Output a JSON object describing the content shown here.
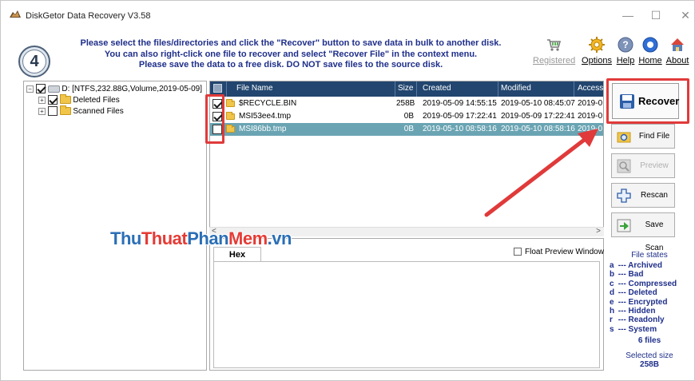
{
  "window": {
    "title": "DiskGetor Data Recovery V3.58",
    "controls": {
      "minimize": "—",
      "maximize": "☐",
      "close": "✕"
    }
  },
  "header": {
    "step": "4",
    "instructions": [
      "Please select the files/directories and click the \"Recover\" button to save data in bulk to another disk.",
      "You can also right-click one file to recover and select \"Recover File\" in the context menu.",
      "Please save the data to a free disk. DO NOT save files to the source disk."
    ],
    "links": [
      {
        "label": "Registered",
        "icon": "cart-icon",
        "disabled": true
      },
      {
        "label": "Options",
        "icon": "gear-icon",
        "disabled": false
      },
      {
        "label": "Help",
        "icon": "help-icon",
        "disabled": false
      },
      {
        "label": "Home",
        "icon": "home-circle-icon",
        "disabled": false
      },
      {
        "label": "About",
        "icon": "house-icon",
        "disabled": false
      }
    ]
  },
  "tree": {
    "root": "D:  [NTFS,232.88G,Volume,2019-05-09]",
    "children": [
      "Deleted Files",
      "Scanned Files"
    ]
  },
  "filelist": {
    "columns": [
      "File Name",
      "Size",
      "Created",
      "Modified",
      "Access"
    ],
    "rows": [
      {
        "name": "$RECYCLE.BIN",
        "size": "258B",
        "created": "2019-05-09 14:55:15",
        "modified": "2019-05-10 08:45:07",
        "accessed": "2019-0",
        "checked": true,
        "selected": false
      },
      {
        "name": "MSI53ee4.tmp",
        "size": "0B",
        "created": "2019-05-09 17:22:41",
        "modified": "2019-05-09 17:22:41",
        "accessed": "2019-0",
        "checked": true,
        "selected": false
      },
      {
        "name": "MSI86bb.tmp",
        "size": "0B",
        "created": "2019-05-10 08:58:16",
        "modified": "2019-05-10 08:58:16",
        "accessed": "2019-0",
        "checked": false,
        "selected": true
      }
    ]
  },
  "preview": {
    "tab": "Hex",
    "float_label": "Float Preview Window"
  },
  "actions": {
    "recover": "Recover",
    "find_file": "Find File",
    "preview_file": "Preview File",
    "rescan": "Rescan",
    "save_scan": "Save Scan"
  },
  "file_states": {
    "title": "File states",
    "items": [
      {
        "key": "a",
        "label": "--- Archived"
      },
      {
        "key": "b",
        "label": "--- Bad"
      },
      {
        "key": "c",
        "label": "--- Compressed"
      },
      {
        "key": "d",
        "label": "--- Deleted"
      },
      {
        "key": "e",
        "label": "--- Encrypted"
      },
      {
        "key": "h",
        "label": "--- Hidden"
      },
      {
        "key": "r",
        "label": "--- Readonly"
      },
      {
        "key": "s",
        "label": "--- System"
      }
    ],
    "files_count": "6 files",
    "selected_size_label": "Selected size",
    "selected_size": "258B"
  },
  "watermark": {
    "parts": [
      "Thu",
      "Thuat",
      "Phan",
      "Mem",
      ".vn"
    ]
  },
  "colors": {
    "header_bg": "#22466f",
    "selected_row": "#6aa4b3",
    "instruction_text": "#1f2f8a",
    "annotation_red": "#e03a3a"
  }
}
